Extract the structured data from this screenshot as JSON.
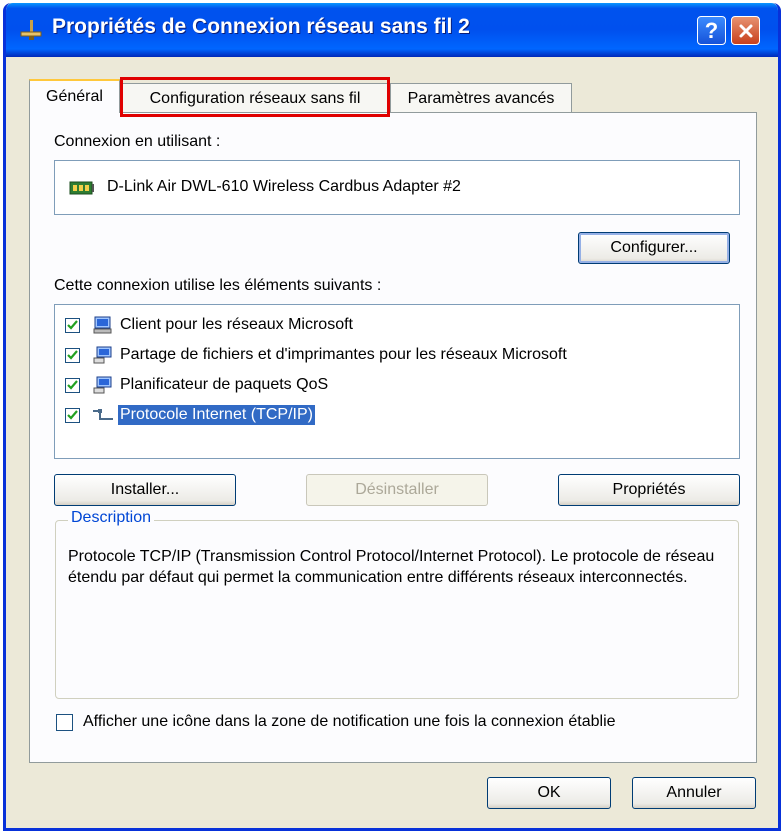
{
  "window": {
    "title": "Propriétés de Connexion réseau sans fil 2",
    "help_glyph": "?",
    "close_icon": "close-icon"
  },
  "tabs": [
    {
      "label": "Général",
      "active": true
    },
    {
      "label": "Configuration réseaux sans fil",
      "active": false,
      "highlighted": true
    },
    {
      "label": "Paramètres avancés",
      "active": false
    }
  ],
  "connection": {
    "label": "Connexion en utilisant :",
    "adapter": "D-Link Air DWL-610 Wireless Cardbus Adapter #2",
    "configure_button": "Configurer..."
  },
  "components": {
    "label": "Cette connexion utilise les éléments suivants :",
    "items": [
      {
        "label": "Client pour les réseaux Microsoft",
        "checked": true,
        "icon": "network-client-icon",
        "selected": false
      },
      {
        "label": "Partage de fichiers et d'imprimantes pour les réseaux Microsoft",
        "checked": true,
        "icon": "file-sharing-icon",
        "selected": false
      },
      {
        "label": "Planificateur de paquets QoS",
        "checked": true,
        "icon": "packet-scheduler-icon",
        "selected": false
      },
      {
        "label": "Protocole Internet (TCP/IP)",
        "checked": true,
        "icon": "protocol-icon",
        "selected": true
      }
    ]
  },
  "buttons": {
    "install": "Installer...",
    "uninstall": "Désinstaller",
    "properties": "Propriétés",
    "ok": "OK",
    "cancel": "Annuler"
  },
  "description": {
    "title": "Description",
    "text": "Protocole TCP/IP (Transmission Control Protocol/Internet Protocol). Le protocole de réseau étendu par défaut qui permet la communication entre différents réseaux interconnectés."
  },
  "notify_checkbox": {
    "label": "Afficher une icône dans la zone de notification une fois la connexion établie",
    "checked": false
  },
  "colors": {
    "titlebar": "#0054e3",
    "selection": "#316ac5",
    "highlight_box": "#e00000",
    "group_title": "#0046d5"
  }
}
